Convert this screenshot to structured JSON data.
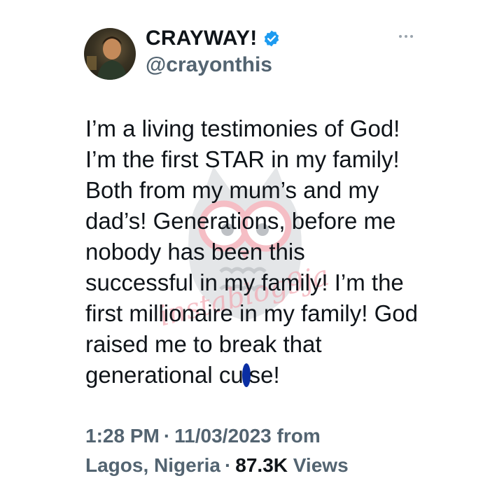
{
  "author": {
    "display_name": "CRAYWAY!",
    "handle": "@crayonthis",
    "verified": true
  },
  "tweet": {
    "lines": [
      "I’m a living testimonies of God!",
      "I’m the first STAR in my family!",
      "Both from my mum’s and my",
      "dad’s! Generations, before me",
      "nobody has been this",
      "successful in my family! I’m the",
      "first millionaire in my family! God",
      "raised me to break that"
    ],
    "last_line_start": "generational cu",
    "last_line_end": "se!"
  },
  "meta": {
    "time": "1:28 PM",
    "separator": "·",
    "date": "11/03/2023",
    "from_label": "from",
    "location": "Lagos, Nigeria",
    "views_count": "87.3K",
    "views_label": "Views"
  },
  "watermark": {
    "text": "instablog9ja"
  },
  "colors": {
    "text": "#0f1419",
    "secondary": "#536471",
    "verified": "#1d9bf0",
    "watermark": "#f2a3ad",
    "redaction": "#0a2ea3"
  },
  "icons": {
    "verified": "verified-badge-icon",
    "more": "more-options-icon"
  }
}
